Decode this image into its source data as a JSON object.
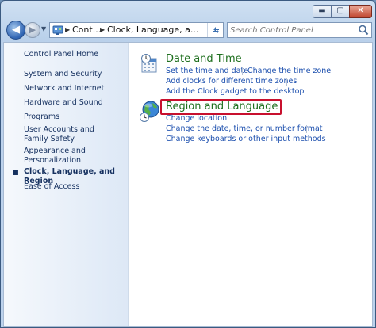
{
  "window": {
    "controls": {
      "minimize": "▬",
      "maximize": "▢",
      "close": "✕"
    }
  },
  "nav": {
    "back_glyph": "◀",
    "forward_glyph": "▶",
    "breadcrumb": [
      "Cont...",
      "Clock, Language, a..."
    ],
    "search_placeholder": "Search Control Panel"
  },
  "sidebar": {
    "home": "Control Panel Home",
    "items": [
      "System and Security",
      "Network and Internet",
      "Hardware and Sound",
      "Programs",
      "User Accounts and Family Safety",
      "Appearance and Personalization",
      "Clock, Language, and Region",
      "Ease of Access"
    ],
    "current_index": 6
  },
  "categories": [
    {
      "title": "Date and Time",
      "icon": "calendar-clock-icon",
      "links": [
        "Set the time and date",
        "Change the time zone",
        "Add clocks for different time zones",
        "Add the Clock gadget to the desktop"
      ]
    },
    {
      "title": "Region and Language",
      "icon": "globe-clock-icon",
      "links": [
        "Change location",
        "Change the date, time, or number format",
        "Change keyboards or other input methods"
      ]
    }
  ],
  "colors": {
    "category_title": "#1e6f1e",
    "link": "#1c4fae",
    "highlight": "#c8102e"
  }
}
